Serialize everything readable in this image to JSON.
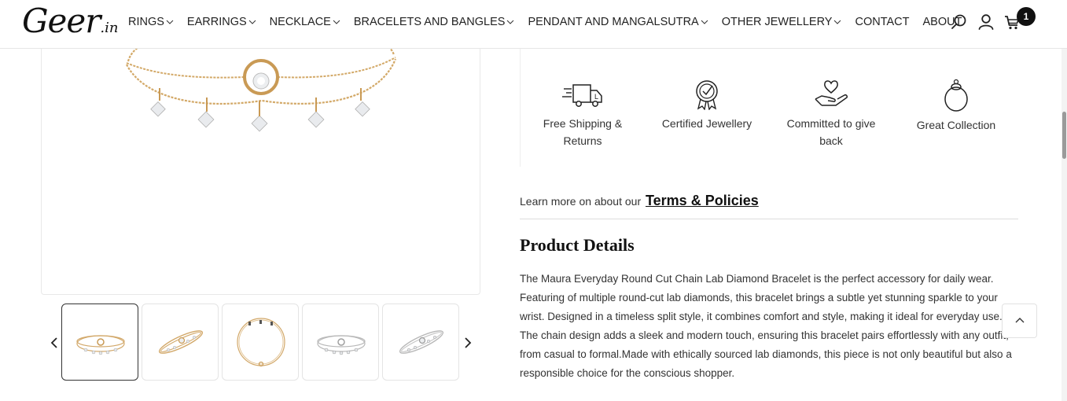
{
  "header": {
    "logo_main": "Geer",
    "logo_tld": ".in",
    "nav": [
      {
        "label": "RINGS",
        "has_dropdown": true
      },
      {
        "label": "EARRINGS",
        "has_dropdown": true
      },
      {
        "label": "NECKLACE",
        "has_dropdown": true
      },
      {
        "label": "BRACELETS AND BANGLES",
        "has_dropdown": true
      },
      {
        "label": "PENDANT AND MANGALSUTRA",
        "has_dropdown": true
      },
      {
        "label": "OTHER JEWELLERY",
        "has_dropdown": true
      },
      {
        "label": "CONTACT",
        "has_dropdown": false
      },
      {
        "label": "ABOUT",
        "has_dropdown": false
      }
    ],
    "icons": [
      "search-icon",
      "user-icon",
      "cart-icon"
    ],
    "cart_count": "1"
  },
  "share": {
    "icons": [
      "facebook-icon",
      "twitter-icon",
      "pinterest-icon",
      "link-icon"
    ]
  },
  "gallery": {
    "thumbnails": [
      {
        "variant": "rose-gold-flat",
        "active": true
      },
      {
        "variant": "rose-gold-angled",
        "active": false
      },
      {
        "variant": "rose-gold-round",
        "active": false
      },
      {
        "variant": "white-gold-flat",
        "active": false
      },
      {
        "variant": "white-gold-angled",
        "active": false
      }
    ]
  },
  "features": [
    {
      "icon": "truck-icon",
      "label": "Free Shipping & Returns"
    },
    {
      "icon": "certified-badge-icon",
      "label": "Certified Jewellery"
    },
    {
      "icon": "heart-hand-icon",
      "label": "Committed to give back"
    },
    {
      "icon": "ring-icon",
      "label": "Great Collection"
    }
  ],
  "terms": {
    "prefix": "Learn more on about our",
    "link": "Terms & Policies"
  },
  "product_details": {
    "title": "Product Details",
    "body": "The Maura Everyday Round Cut Chain Lab Diamond Bracelet is the perfect accessory for daily wear. Featuring of multiple round-cut lab diamonds, this bracelet brings a subtle yet stunning sparkle to your wrist. Designed in a timeless split style, it combines comfort and style, making it ideal for everyday use. The chain design adds a sleek and modern touch, ensuring this bracelet pairs effortlessly with any outfit, from casual to formal.Made with ethically sourced lab diamonds, this piece is not only beautiful but also a responsible choice for the conscious shopper."
  },
  "colors": {
    "gold": "#c99a55",
    "gold_light": "#e2c08a",
    "text": "#333333",
    "border": "#e4e4e4"
  }
}
